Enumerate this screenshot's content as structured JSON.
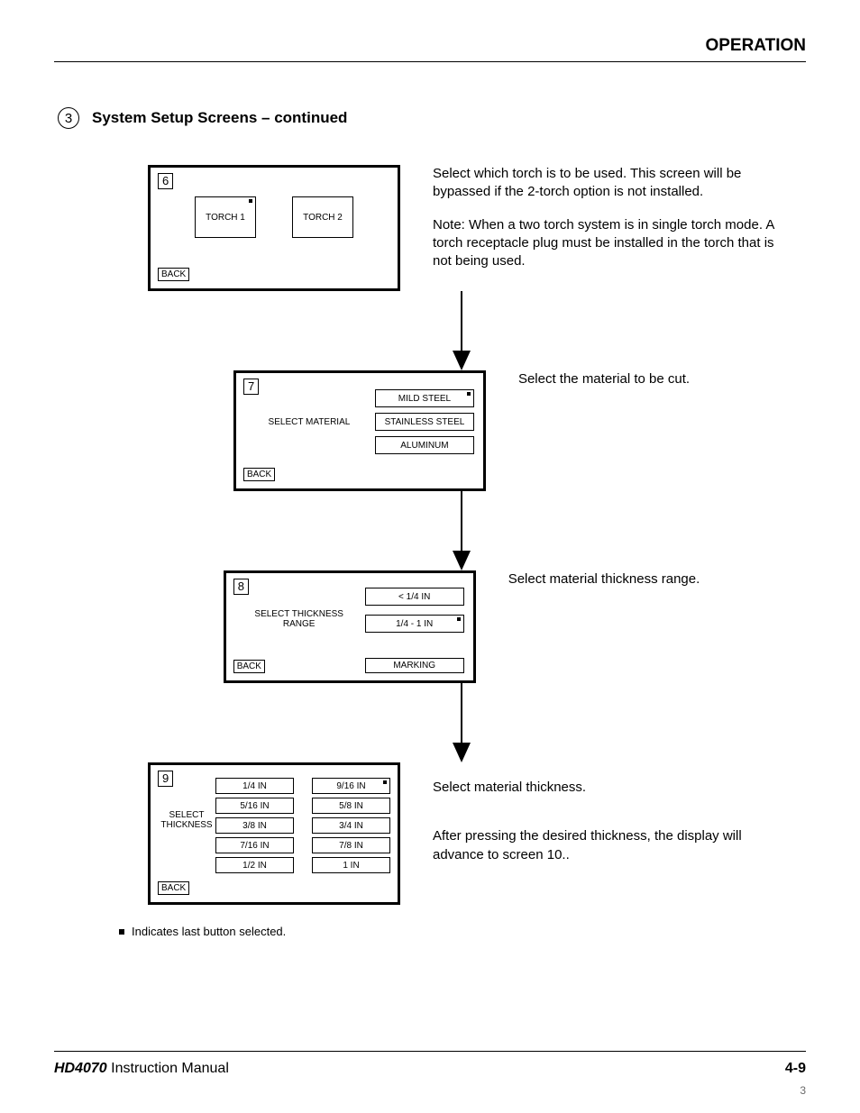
{
  "header": {
    "title": "OPERATION"
  },
  "section": {
    "num": "3",
    "title": "System Setup Screens – continued"
  },
  "screens": {
    "s6": {
      "num": "6",
      "back": "BACK",
      "opt1": "TORCH 1",
      "opt2": "TORCH 2"
    },
    "s7": {
      "num": "7",
      "back": "BACK",
      "label": "SELECT MATERIAL",
      "o1": "MILD STEEL",
      "o2": "STAINLESS STEEL",
      "o3": "ALUMINUM"
    },
    "s8": {
      "num": "8",
      "back": "BACK",
      "label1": "SELECT THICKNESS",
      "label2": "RANGE",
      "o1": "<   1/4 IN",
      "o2": "1/4 - 1 IN",
      "marking": "MARKING"
    },
    "s9": {
      "num": "9",
      "back": "BACK",
      "label1": "SELECT",
      "label2": "THICKNESS",
      "l1": "1/4 IN",
      "l2": "5/16 IN",
      "l3": "3/8 IN",
      "l4": "7/16 IN",
      "l5": "1/2 IN",
      "r1": "9/16 IN",
      "r2": "5/8 IN",
      "r3": "3/4 IN",
      "r4": "7/8 IN",
      "r5": "1 IN"
    }
  },
  "desc": {
    "d6a": "Select which torch is to be used. This screen will be bypassed if the 2-torch option is not installed.",
    "d6b_lead": "Note:",
    "d6b_body": "When a two torch system is in single torch mode. A torch receptacle plug must be installed in the torch that is not being used.",
    "d7": "Select the material to be cut.",
    "d8": "Select material thickness range.",
    "d9a": "Select material thickness.",
    "d9b": "After pressing the desired thickness, the display will advance to screen 10.."
  },
  "footnote": "Indicates last button selected.",
  "footer": {
    "product": "HD4070",
    "manual": " Instruction Manual",
    "page": "4-9",
    "pdf_page": "3"
  }
}
